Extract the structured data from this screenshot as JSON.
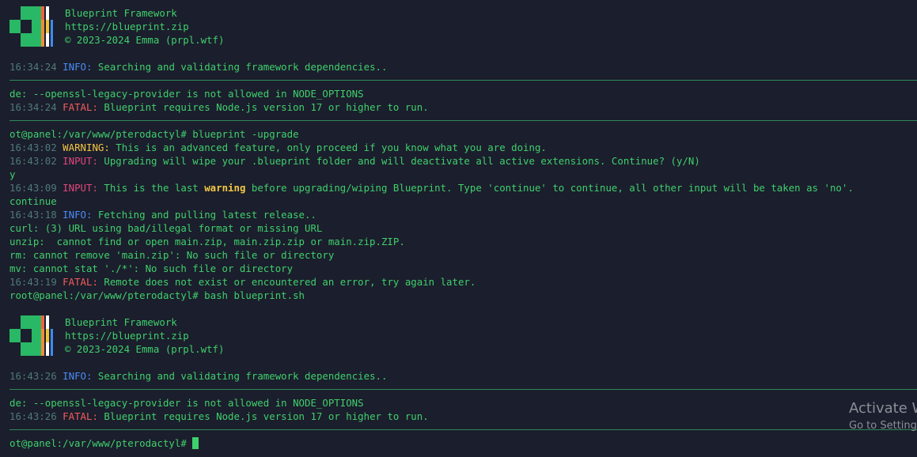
{
  "banner": {
    "name": "Blueprint Framework",
    "url": "https://blueprint.zip",
    "copyright": "© 2023-2024 Emma (prpl.wtf)"
  },
  "colors": {
    "background": "#1b1e2c",
    "text": "#3fd06d",
    "timestamp": "#4f7a78",
    "info": "#4a8cf6",
    "fatal": "#f25c5c",
    "warning": "#f2c744",
    "input": "#e0477d"
  },
  "block1": {
    "info_ts": "16:34:24",
    "info_label": "INFO:",
    "info_msg": " Searching and validating framework dependencies..",
    "node_error": "de: --openssl-legacy-provider is not allowed in NODE_OPTIONS",
    "fatal_ts": "16:34:24",
    "fatal_label": "FATAL:",
    "fatal_msg": " Blueprint requires Node.js version 17 or higher to run."
  },
  "session": {
    "prompt_cmd": "ot@panel:/var/www/pterodactyl# blueprint -upgrade",
    "warning_ts": "16:43:02",
    "warning_label": "WARNING:",
    "warning_msg": " This is an advanced feature, only proceed if you know what you are doing.",
    "input1_ts": "16:43:02",
    "input1_label": "INPUT:",
    "input1_msg": " Upgrading will wipe your .blueprint folder and will deactivate all active extensions. Continue? (y/N)",
    "answer1": "y",
    "input2_ts": "16:43:09",
    "input2_label": "INPUT:",
    "input2_msg_a": " This is the last ",
    "input2_warn": "warning",
    "input2_msg_b": " before upgrading/wiping Blueprint. Type 'continue' to continue, all other input will be taken as 'no'.",
    "answer2": "continue",
    "info_ts": "16:43:18",
    "info_label": "INFO:",
    "info_msg": " Fetching and pulling latest release..",
    "curl_err": "curl: (3) URL using bad/illegal format or missing URL",
    "unzip_err": "unzip:  cannot find or open main.zip, main.zip.zip or main.zip.ZIP.",
    "rm_err": "rm: cannot remove 'main.zip': No such file or directory",
    "mv_err": "mv: cannot stat './*': No such file or directory",
    "fatal_ts": "16:43:19",
    "fatal_label": "FATAL:",
    "fatal_msg": " Remote does not exist or encountered an error, try again later.",
    "prompt2_cmd": "root@panel:/var/www/pterodactyl# bash blueprint.sh"
  },
  "block2": {
    "info_ts": "16:43:26",
    "info_label": "INFO:",
    "info_msg": " Searching and validating framework dependencies..",
    "node_error": "de: --openssl-legacy-provider is not allowed in NODE_OPTIONS",
    "fatal_ts": "16:43:26",
    "fatal_label": "FATAL:",
    "fatal_msg": " Blueprint requires Node.js version 17 or higher to run."
  },
  "final_prompt": "ot@panel:/var/www/pterodactyl# ",
  "watermark": {
    "title": "Activate Wi",
    "subtitle": "Go to Setting"
  }
}
